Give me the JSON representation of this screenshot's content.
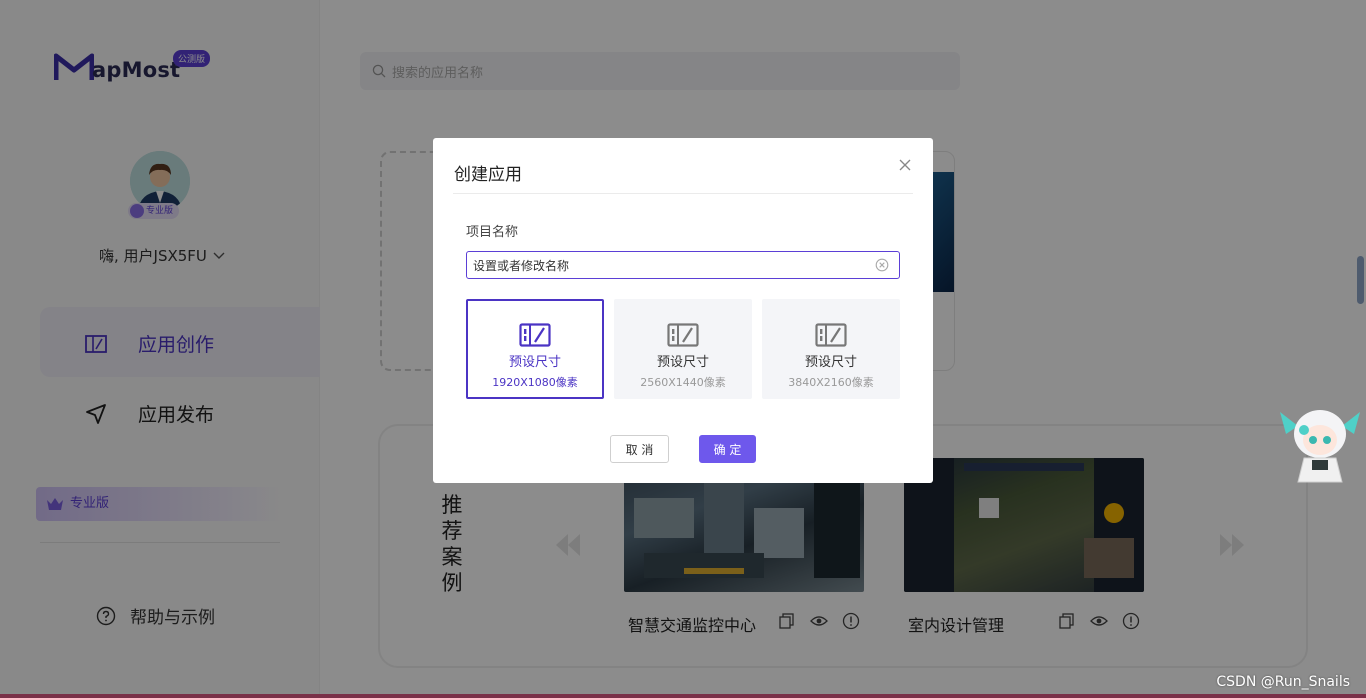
{
  "app": {
    "logo_text": "apMost",
    "beta_badge": "公测版"
  },
  "user": {
    "tier_badge": "专业版",
    "greeting": "嗨, 用户JSX5FU"
  },
  "sidebar": {
    "items": [
      {
        "label": "应用创作",
        "icon": "app-create-icon",
        "active": true
      },
      {
        "label": "应用发布",
        "icon": "send-icon",
        "active": false
      }
    ],
    "pro_banner": "专业版",
    "help": "帮助与示例"
  },
  "search": {
    "placeholder": "搜索的应用名称"
  },
  "recommend": {
    "title": "推荐案例",
    "cases": [
      {
        "name": "智慧交通监控中心"
      },
      {
        "name": "室内设计管理"
      }
    ]
  },
  "modal": {
    "title": "创建应用",
    "field_label": "项目名称",
    "input_value": "设置或者修改名称",
    "size_options": [
      {
        "label": "预设尺寸",
        "size": "1920X1080像素",
        "selected": true
      },
      {
        "label": "预设尺寸",
        "size": "2560X1440像素",
        "selected": false
      },
      {
        "label": "预设尺寸",
        "size": "3840X2160像素",
        "selected": false
      }
    ],
    "cancel_label": "取 消",
    "ok_label": "确 定"
  },
  "colors": {
    "accent": "#4b34c4",
    "primary_button": "#6e58ec",
    "overlay": "rgba(0,0,0,0.45)"
  },
  "watermark": "CSDN @Run_Snails"
}
